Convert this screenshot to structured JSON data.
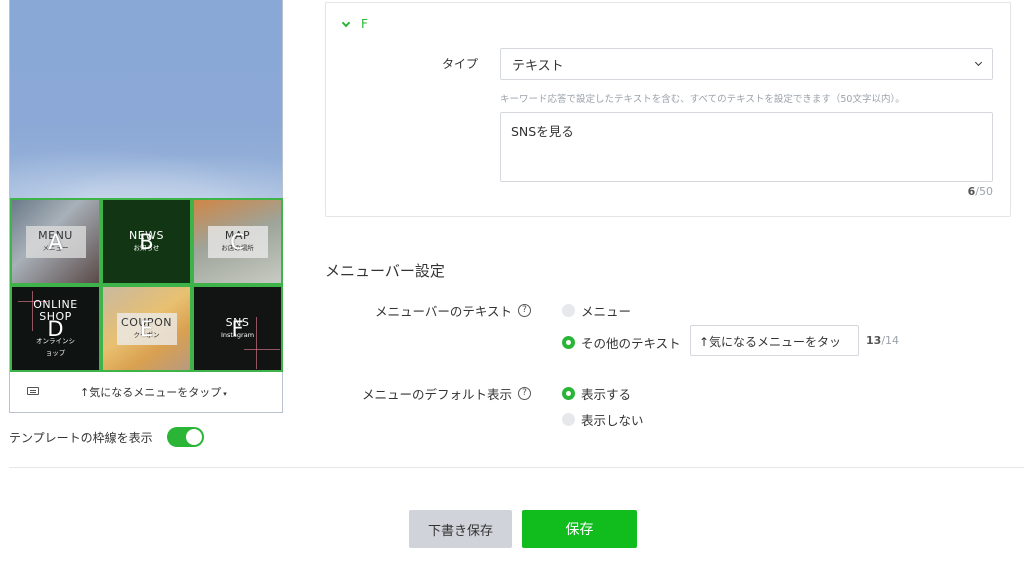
{
  "preview": {
    "cells": [
      {
        "letter": "A",
        "title": "MENU",
        "subtitle": "メニュー"
      },
      {
        "letter": "B",
        "title": "NEWS",
        "subtitle": "お知らせ"
      },
      {
        "letter": "C",
        "title": "MAP",
        "subtitle": "お店の場所"
      },
      {
        "letter": "D",
        "title": "ONLINE\nSHOP",
        "subtitle": "オンラインショップ"
      },
      {
        "letter": "E",
        "title": "COUPON",
        "subtitle": "クーポン"
      },
      {
        "letter": "F",
        "title": "SNS",
        "subtitle": "Instagram"
      }
    ],
    "menubar_text": "↑気になるメニューをタップ",
    "menubar_caret": "▾",
    "toggle_label": "テンプレートの枠線を表示",
    "toggle_on": true
  },
  "section_f": {
    "header": "F",
    "type_label": "タイプ",
    "type_value": "テキスト",
    "hint": "キーワード応答で設定したテキストを含む、すべてのテキストを設定できます（50文字以内）。",
    "text_value": "SNSを見る",
    "count_current": "6",
    "count_max": "/50"
  },
  "menubar_settings": {
    "heading": "メニューバー設定",
    "text_label": "メニューバーのテキスト",
    "qmark": "?",
    "option_menu": "メニュー",
    "option_other": "その他のテキスト",
    "other_value": "↑気になるメニューをタッ",
    "other_count_current": "13",
    "other_count_max": "/14",
    "default_label": "メニューのデフォルト表示",
    "option_show": "表示する",
    "option_hide": "表示しない"
  },
  "buttons": {
    "draft": "下書き保存",
    "save": "保存"
  },
  "colors": {
    "accent": "#2bb537",
    "save_button": "#10bd1c",
    "draft_button": "#d0d4da"
  }
}
